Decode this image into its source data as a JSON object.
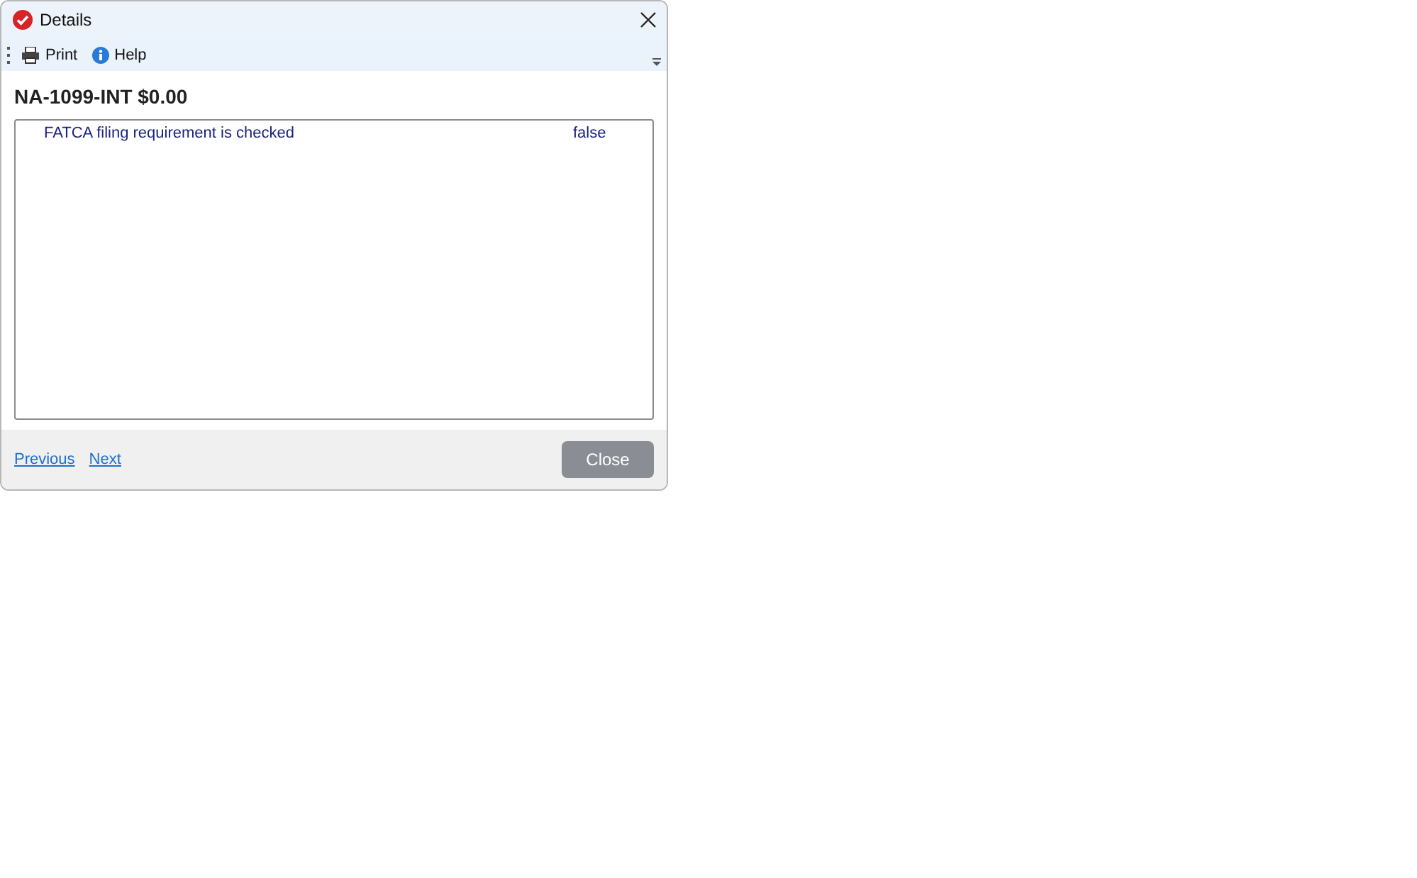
{
  "window": {
    "title": "Details"
  },
  "toolbar": [
    {
      "kind": "print",
      "label": "Print"
    },
    {
      "kind": "help",
      "label": "Help"
    }
  ],
  "heading": "NA-1099-INT $0.00",
  "details": [
    {
      "label": "FATCA filing requirement is checked",
      "value": "false"
    }
  ],
  "footer": {
    "links": [
      "Previous",
      "Next"
    ],
    "button": "Close"
  }
}
